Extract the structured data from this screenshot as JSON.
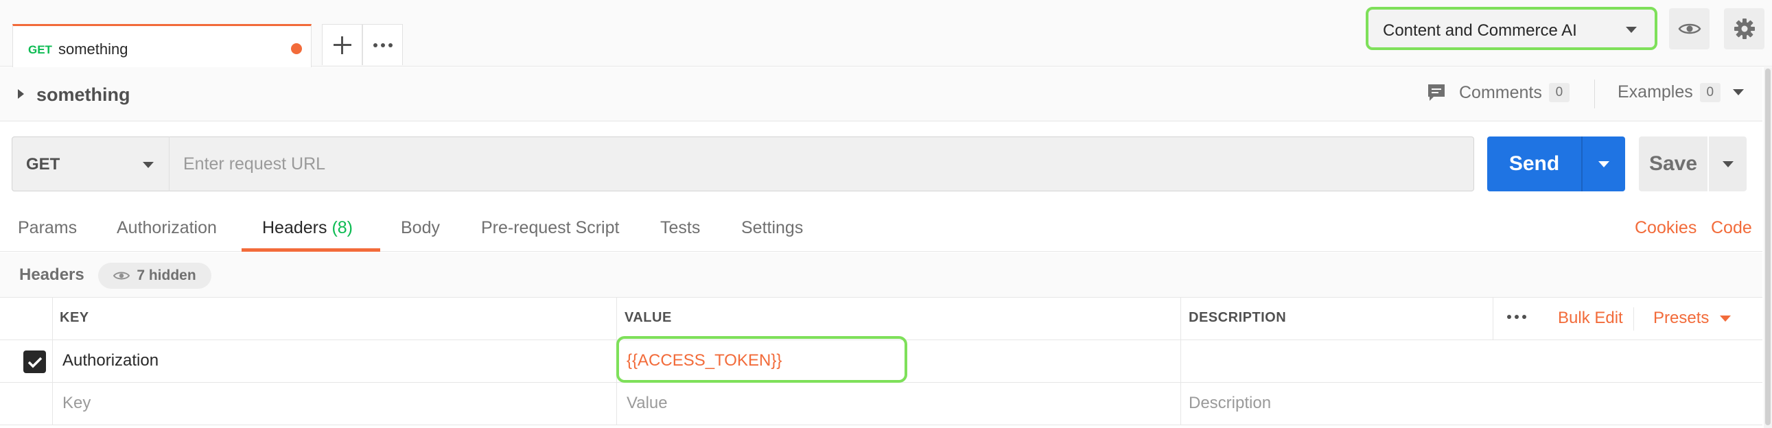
{
  "tab": {
    "method": "GET",
    "name": "something",
    "unsaved": true
  },
  "environment": {
    "selected": "Content and Commerce AI"
  },
  "request": {
    "name": "something"
  },
  "comments": {
    "label": "Comments",
    "count": "0"
  },
  "examples": {
    "label": "Examples",
    "count": "0"
  },
  "url_bar": {
    "method": "GET",
    "url": "",
    "placeholder": "Enter request URL",
    "send_label": "Send",
    "save_label": "Save"
  },
  "subtabs": {
    "params": "Params",
    "authorization": "Authorization",
    "headers": "Headers",
    "headers_count": "(8)",
    "body": "Body",
    "prerequest": "Pre-request Script",
    "tests": "Tests",
    "settings": "Settings",
    "cookies": "Cookies",
    "code": "Code"
  },
  "headers_section": {
    "title": "Headers",
    "hidden": "7 hidden"
  },
  "table": {
    "columns": {
      "key": "KEY",
      "value": "VALUE",
      "description": "DESCRIPTION"
    },
    "bulk_edit": "Bulk Edit",
    "presets": "Presets",
    "rows": [
      {
        "checked": true,
        "key": "Authorization",
        "value": "{{ACCESS_TOKEN}}",
        "description": ""
      }
    ],
    "placeholders": {
      "key": "Key",
      "value": "Value",
      "description": "Description"
    }
  },
  "colors": {
    "accent": "#f26b3a",
    "send": "#1f74e3",
    "highlight": "#7ee05a",
    "method_get": "#0cbb52"
  }
}
